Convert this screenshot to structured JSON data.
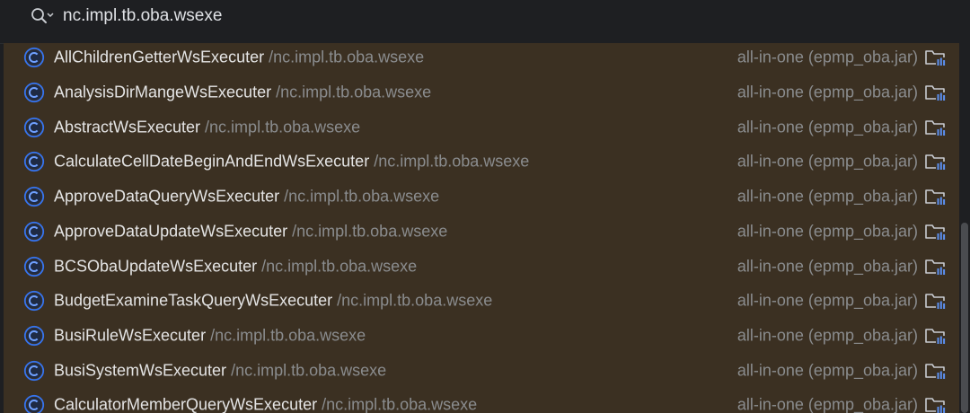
{
  "search": {
    "value": "nc.impl.tb.oba.wsexe",
    "icon": "search-with-options-icon"
  },
  "colors": {
    "background": "#1e1f22",
    "results_background": "#3b3022",
    "class_icon_blue": "#3574f0",
    "name_text": "#e4e4e4",
    "secondary_text": "#8a8c8e"
  },
  "results": [
    {
      "name": "AllChildrenGetterWsExecuter",
      "package": "/nc.impl.tb.oba.wsexe",
      "module": "all-in-one (epmp_oba.jar)"
    },
    {
      "name": "AnalysisDirMangeWsExecuter",
      "package": "/nc.impl.tb.oba.wsexe",
      "module": "all-in-one (epmp_oba.jar)"
    },
    {
      "name": "AbstractWsExecuter",
      "package": "/nc.impl.tb.oba.wsexe",
      "module": "all-in-one (epmp_oba.jar)"
    },
    {
      "name": "CalculateCellDateBeginAndEndWsExecuter",
      "package": "/nc.impl.tb.oba.wsexe",
      "module": "all-in-one (epmp_oba.jar)"
    },
    {
      "name": "ApproveDataQueryWsExecuter",
      "package": "/nc.impl.tb.oba.wsexe",
      "module": "all-in-one (epmp_oba.jar)"
    },
    {
      "name": "ApproveDataUpdateWsExecuter",
      "package": "/nc.impl.tb.oba.wsexe",
      "module": "all-in-one (epmp_oba.jar)"
    },
    {
      "name": "BCSObaUpdateWsExecuter",
      "package": "/nc.impl.tb.oba.wsexe",
      "module": "all-in-one (epmp_oba.jar)"
    },
    {
      "name": "BudgetExamineTaskQueryWsExecuter",
      "package": "/nc.impl.tb.oba.wsexe",
      "module": "all-in-one (epmp_oba.jar)"
    },
    {
      "name": "BusiRuleWsExecuter",
      "package": "/nc.impl.tb.oba.wsexe",
      "module": "all-in-one (epmp_oba.jar)"
    },
    {
      "name": "BusiSystemWsExecuter",
      "package": "/nc.impl.tb.oba.wsexe",
      "module": "all-in-one (epmp_oba.jar)"
    },
    {
      "name": "CalculatorMemberQueryWsExecuter",
      "package": "/nc.impl.tb.oba.wsexe",
      "module": "all-in-one (epmp_oba.jar)"
    }
  ]
}
